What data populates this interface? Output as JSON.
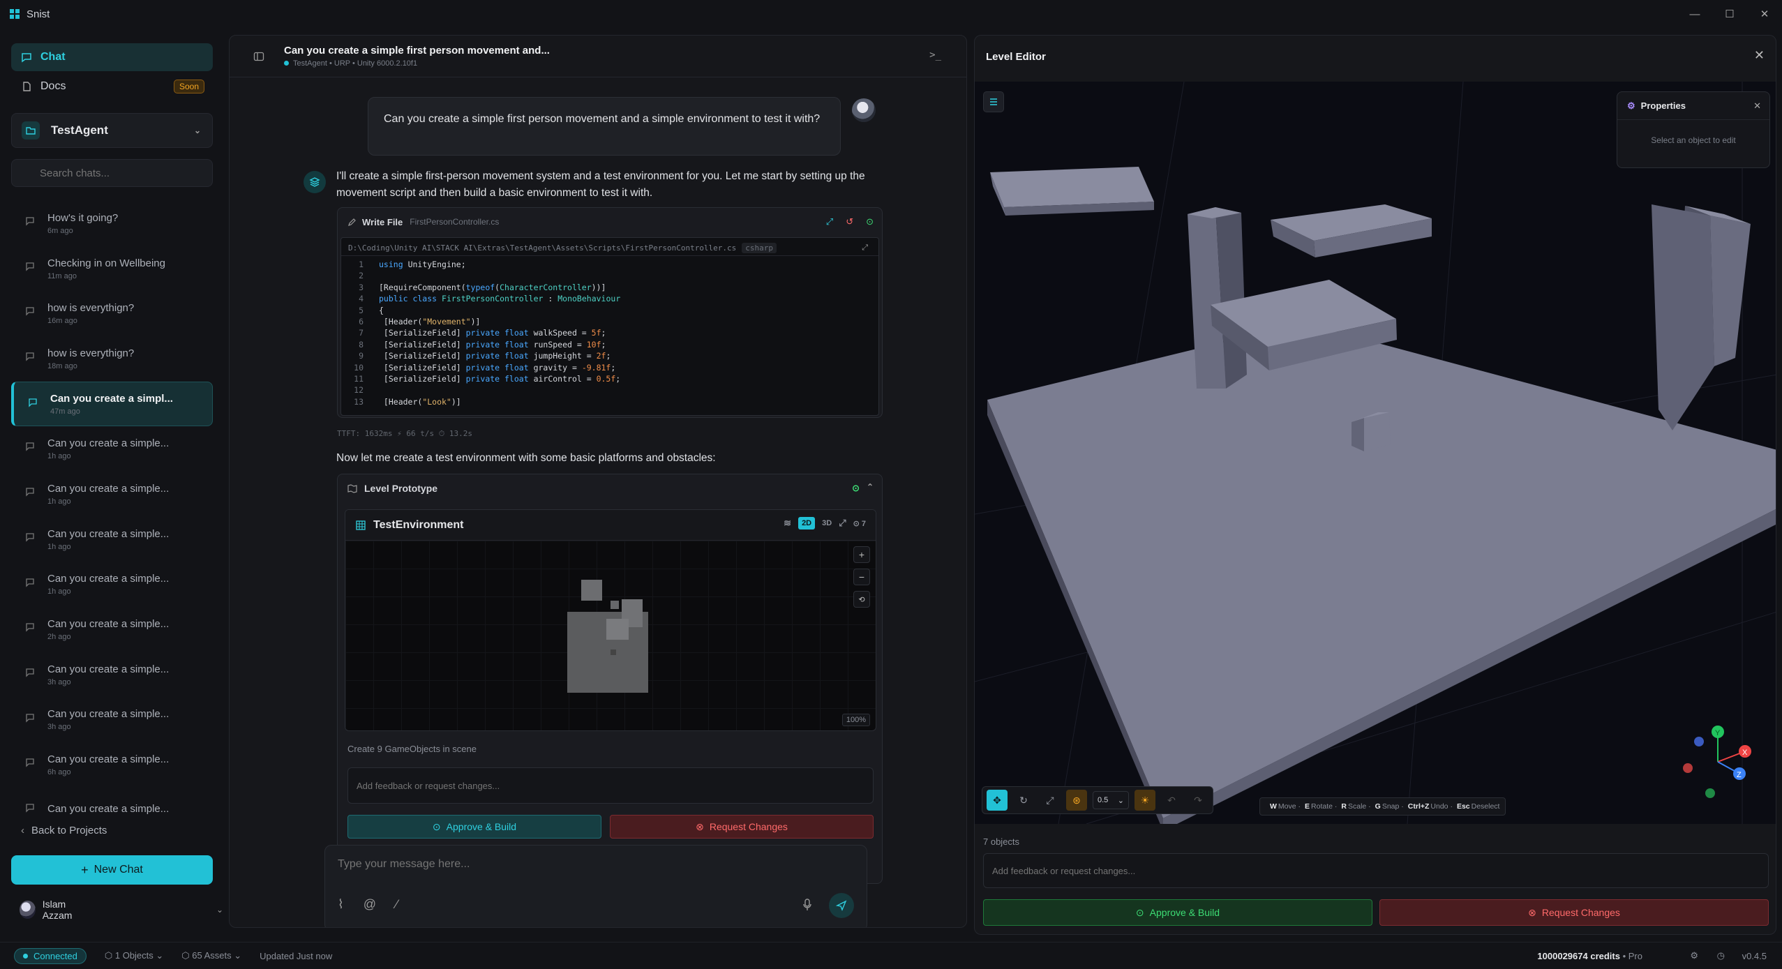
{
  "app": {
    "title": "Snist"
  },
  "sidebar": {
    "nav": {
      "chat": "Chat",
      "docs": "Docs",
      "soon": "Soon"
    },
    "project": "TestAgent",
    "search_placeholder": "Search chats...",
    "chats": [
      {
        "title": "How's it going?",
        "time": "6m ago"
      },
      {
        "title": "Checking in on Wellbeing",
        "time": "11m ago"
      },
      {
        "title": "how is everythign?",
        "time": "16m ago"
      },
      {
        "title": "how is everythign?",
        "time": "18m ago"
      },
      {
        "title": "Can you create a simpl...",
        "time": "47m ago",
        "active": true
      },
      {
        "title": "Can you create a simple...",
        "time": "1h ago"
      },
      {
        "title": "Can you create a simple...",
        "time": "1h ago"
      },
      {
        "title": "Can you create a simple...",
        "time": "1h ago"
      },
      {
        "title": "Can you create a simple...",
        "time": "1h ago"
      },
      {
        "title": "Can you create a simple...",
        "time": "2h ago"
      },
      {
        "title": "Can you create a simple...",
        "time": "3h ago"
      },
      {
        "title": "Can you create a simple...",
        "time": "3h ago"
      },
      {
        "title": "Can you create a simple...",
        "time": "6h ago"
      },
      {
        "title": "Can you create a simple...",
        "time": ""
      }
    ],
    "back": "Back to Projects",
    "new_chat": "New Chat",
    "user": "Islam Azzam"
  },
  "chat": {
    "title": "Can you create a simple first person movement and...",
    "meta": "TestAgent  •  URP  •  Unity 6000.2.10f1",
    "user_message": "Can you create a simple first person movement and a simple environment to test it with?",
    "bot_message": "I'll create a simple first-person movement system and a test environment for you. Let me start by setting up the movement script and then build a basic environment to test it with.",
    "write_file": {
      "label": "Write File",
      "filename": "FirstPersonController.cs",
      "path": "D:\\Coding\\Unity AI\\STACK AI\\Extras\\TestAgent\\Assets\\Scripts\\FirstPersonController.cs",
      "lang": "csharp"
    },
    "stats": "TTFT: 1632ms   ⚡ 66 t/s   ⏱ 13.2s",
    "second_message": "Now let me create a test environment with some basic platforms and obstacles:",
    "prototype": {
      "label": "Level Prototype",
      "env_name": "TestEnvironment",
      "mode_2d": "2D",
      "mode_3d": "3D",
      "count": "7",
      "zoom": "100%",
      "caption": "Create 9 GameObjects in scene",
      "feedback_placeholder": "Add feedback or request changes...",
      "approve": "Approve & Build",
      "request": "Request Changes"
    },
    "composer_placeholder": "Type your message here..."
  },
  "editor": {
    "title": "Level Editor",
    "properties": {
      "title": "Properties",
      "empty": "Select an object to edit"
    },
    "snap_value": "0.5",
    "hints": {
      "w": "W",
      "w_t": "Move ·",
      "e": "E",
      "e_t": "Rotate ·",
      "r": "R",
      "r_t": "Scale ·",
      "g": "G",
      "g_t": "Snap ·",
      "cz": "Ctrl+Z",
      "cz_t": "Undo ·",
      "esc": "Esc",
      "esc_t": "Deselect"
    },
    "axes": {
      "x": "X",
      "y": "Y",
      "z": "Z"
    },
    "objects": "7 objects",
    "feedback_placeholder": "Add feedback or request changes...",
    "approve": "Approve & Build",
    "request": "Request Changes"
  },
  "status": {
    "connected": "Connected",
    "objects": "1 Objects",
    "assets": "65 Assets",
    "updated": "Updated Just now",
    "credits": "1000029674 credits",
    "plan": "• Pro",
    "version": "v0.4.5"
  }
}
